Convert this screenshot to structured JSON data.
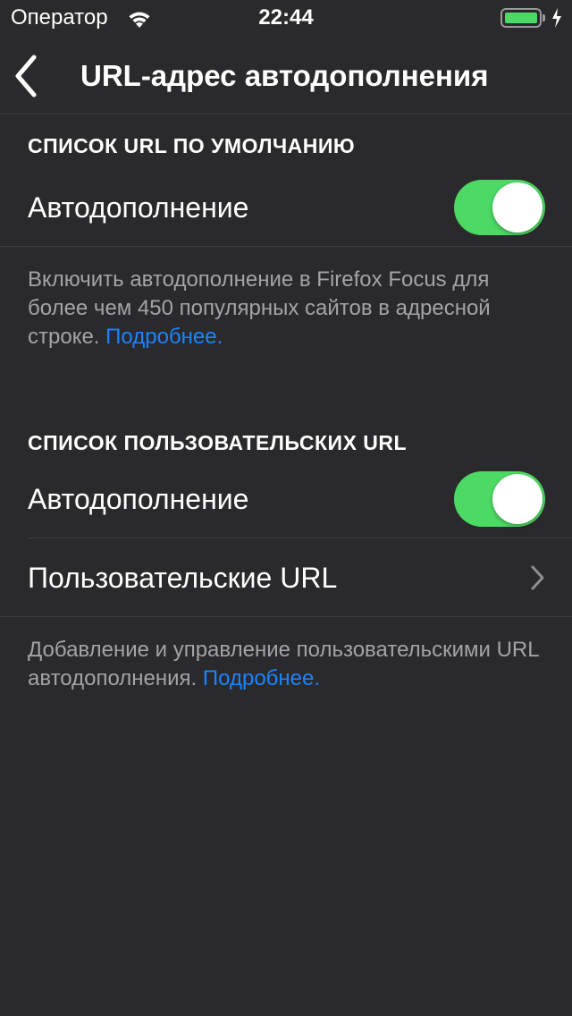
{
  "status_bar": {
    "carrier": "Оператор",
    "time": "22:44",
    "battery_level": 1.0,
    "icons": [
      "wifi-icon",
      "battery-icon",
      "charging-bolt-icon"
    ]
  },
  "nav": {
    "title": "URL-адрес автодополнения",
    "back_icon": "chevron-left-icon"
  },
  "sections": [
    {
      "header": "СПИСОК URL ПО УМОЛЧАНИЮ",
      "toggle_label": "Автодополнение",
      "toggle_on": true,
      "footer": "Включить автодополнение в Firefox Focus для более чем 450 популярных сайтов в адресной строке.",
      "footer_link": "Подробнее."
    },
    {
      "header": "СПИСОК ПОЛЬЗОВАТЕЛЬСКИХ URL",
      "toggle_label": "Автодополнение",
      "toggle_on": true,
      "nav_row_label": "Пользовательские URL",
      "footer": "Добавление и управление пользовательскими URL автодополнения.",
      "footer_link": "Подробнее."
    }
  ],
  "colors": {
    "background": "#2a2a2c",
    "toggle_on": "#4cd964",
    "link": "#1a84ff",
    "footer_text": "#a3a3a8"
  }
}
